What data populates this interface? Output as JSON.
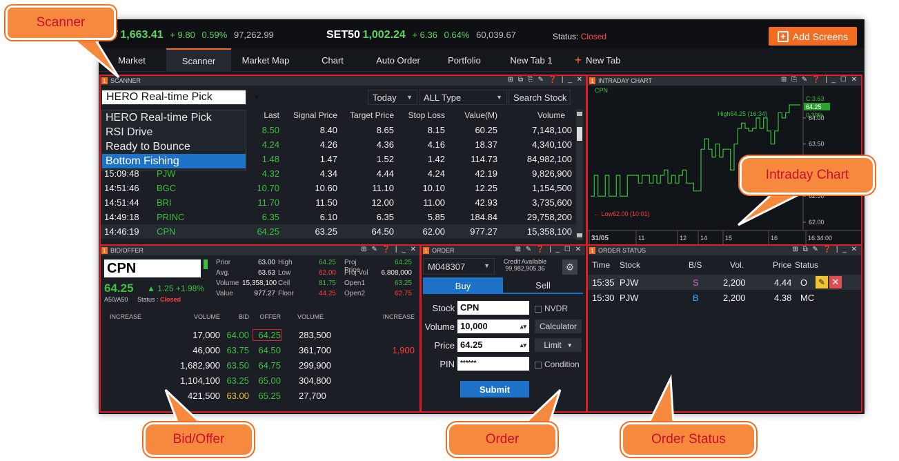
{
  "ticker": {
    "set_index_label": "T",
    "set_value": "1,663.41",
    "set_change": "+ 9.80",
    "set_pct": "0.59%",
    "set_volume": "97,262.99",
    "set50_label": "SET50",
    "set50_value": "1,002.24",
    "set50_change": "+ 6.36",
    "set50_pct": "0.64%",
    "set50_volume": "60,039.67",
    "status_label": "Status:",
    "status_value": "Closed",
    "add_screens_label": "Add Screens"
  },
  "tabs": [
    {
      "label": "Market"
    },
    {
      "label": "Scanner"
    },
    {
      "label": "Market Map"
    },
    {
      "label": "Chart"
    },
    {
      "label": "Auto Order"
    },
    {
      "label": "Portfolio"
    },
    {
      "label": "New Tab 1"
    },
    {
      "label": "New Tab"
    }
  ],
  "scanner": {
    "panel_num": "1",
    "panel_title": "SCANNER",
    "selected_scanner": "HERO Real-time Pick",
    "period": "Today",
    "type": "ALL Type",
    "search_placeholder": "Search Stock",
    "dropdown_options": [
      "HERO Real-time Pick",
      "RSI Drive",
      "Ready to Bounce",
      "Bottom Fishing"
    ],
    "columns": [
      "Last",
      "Signal Price",
      "Target Price",
      "Stop Loss",
      "Value(M)",
      "Volume"
    ],
    "rows": [
      {
        "time": "",
        "stock": "",
        "last": "8.50",
        "signal": "8.40",
        "target": "8.65",
        "stop": "8.15",
        "value": "60.25",
        "volume": "7,148,100"
      },
      {
        "time": "",
        "stock": "",
        "last": "4.24",
        "signal": "4.26",
        "target": "4.36",
        "stop": "4.16",
        "value": "18.37",
        "volume": "4,340,100"
      },
      {
        "time": "",
        "stock": "",
        "last": "1.48",
        "signal": "1.47",
        "target": "1.52",
        "stop": "1.42",
        "value": "114.73",
        "volume": "84,982,100"
      },
      {
        "time": "15:09:48",
        "stock": "PJW",
        "last": "4.32",
        "signal": "4.34",
        "target": "4.44",
        "stop": "4.24",
        "value": "42.19",
        "volume": "9,826,900"
      },
      {
        "time": "14:51:46",
        "stock": "BGC",
        "last": "10.70",
        "signal": "10.60",
        "target": "11.10",
        "stop": "10.10",
        "value": "12.25",
        "volume": "1,154,500"
      },
      {
        "time": "14:51:44",
        "stock": "BRI",
        "last": "11.70",
        "signal": "11.50",
        "target": "12.00",
        "stop": "11.00",
        "value": "42.93",
        "volume": "3,735,600"
      },
      {
        "time": "14:49:18",
        "stock": "PRINC",
        "last": "6.35",
        "signal": "6.10",
        "target": "6.35",
        "stop": "5.85",
        "value": "184.84",
        "volume": "29,758,200"
      },
      {
        "time": "14:46:19",
        "stock": "CPN",
        "last": "64.25",
        "signal": "63.25",
        "target": "64.50",
        "stop": "62.00",
        "value": "977.27",
        "volume": "15,358,100"
      }
    ]
  },
  "intraday": {
    "panel_num": "1",
    "panel_title": "INTRADAY CHART",
    "symbol": "CPN",
    "high_label": "High64.25 (16:34)",
    "low_label": "Low62.00 (10:01)",
    "last_badge": "64.25",
    "pct_badge": "0.39%",
    "change_badge": "C:3.63",
    "y_ticks": [
      "64.00",
      "63.50",
      "63.00",
      "62.50",
      "62.00"
    ],
    "x_ticks": [
      "31/05",
      "11",
      "12",
      "14",
      "15",
      "16",
      "16:34:00"
    ]
  },
  "bidoffer": {
    "panel_num": "1",
    "panel_title": "BID/OFFER",
    "symbol": "CPN",
    "last": "64.25",
    "change": "▲  1.25 +1.98%",
    "sub": "A50/A50",
    "status_label": "Status :",
    "status_value": "Closed",
    "stats": [
      [
        "Prior",
        "63.00",
        "High",
        "64.25",
        "Proj Price",
        "64.25"
      ],
      [
        "Avg.",
        "63.63",
        "Low",
        "62.00",
        "Proj Vol",
        "6,808,000"
      ],
      [
        "Volume",
        "15,358,100",
        "Ceil",
        "81.75",
        "Open1",
        "63.25"
      ],
      [
        "Value",
        "977.27",
        "Floor",
        "44.25",
        "Open2",
        "62.75"
      ]
    ],
    "headers": [
      "INCREASE",
      "VOLUME",
      "BID",
      "OFFER",
      "VOLUME",
      "INCREASE"
    ],
    "rows": [
      {
        "inc_b": "",
        "vol_b": "17,000",
        "bid": "64.00",
        "offer": "64.25",
        "vol_o": "283,500",
        "inc_o": ""
      },
      {
        "inc_b": "",
        "vol_b": "46,000",
        "bid": "63.75",
        "offer": "64.50",
        "vol_o": "361,700",
        "inc_o": "1,900"
      },
      {
        "inc_b": "",
        "vol_b": "1,682,900",
        "bid": "63.50",
        "offer": "64.75",
        "vol_o": "299,900",
        "inc_o": ""
      },
      {
        "inc_b": "",
        "vol_b": "1,104,100",
        "bid": "63.25",
        "offer": "65.00",
        "vol_o": "304,800",
        "inc_o": ""
      },
      {
        "inc_b": "",
        "vol_b": "421,500",
        "bid": "63.00",
        "offer": "65.25",
        "vol_o": "27,700",
        "inc_o": ""
      }
    ]
  },
  "order": {
    "panel_num": "1",
    "panel_title": "ORDER",
    "account": "M048307",
    "credit_label": "Credit Available",
    "credit_value": "99,982,905.36",
    "buy_label": "Buy",
    "sell_label": "Sell",
    "stock_label": "Stock",
    "stock_value": "CPN",
    "nvdr_label": "NVDR",
    "volume_label": "Volume",
    "volume_value": "10,000",
    "calculator_label": "Calculator",
    "price_label": "Price",
    "price_value": "64.25",
    "limit_label": "Limit",
    "pin_label": "PIN",
    "pin_value": "******",
    "condition_label": "Condition",
    "submit_label": "Submit"
  },
  "order_status": {
    "panel_num": "1",
    "panel_title": "ORDER STATUS",
    "headers": [
      "Time",
      "Stock",
      "B/S",
      "Vol.",
      "Price",
      "Status"
    ],
    "rows": [
      {
        "time": "15:35",
        "stock": "PJW",
        "bs": "S",
        "vol": "2,200",
        "price": "4.44",
        "status": "O"
      },
      {
        "time": "15:30",
        "stock": "PJW",
        "bs": "B",
        "vol": "2,200",
        "price": "4.38",
        "status": "MC"
      }
    ]
  },
  "callouts": {
    "scanner": "Scanner",
    "intraday": "Intraday Chart",
    "bidoffer": "Bid/Offer",
    "order": "Order",
    "order_status": "Order Status"
  },
  "colors": {
    "accent": "#f36c21",
    "up": "#3fbf3f",
    "down": "#ff4040",
    "highlight": "#e01c24",
    "select": "#1e73c8"
  }
}
